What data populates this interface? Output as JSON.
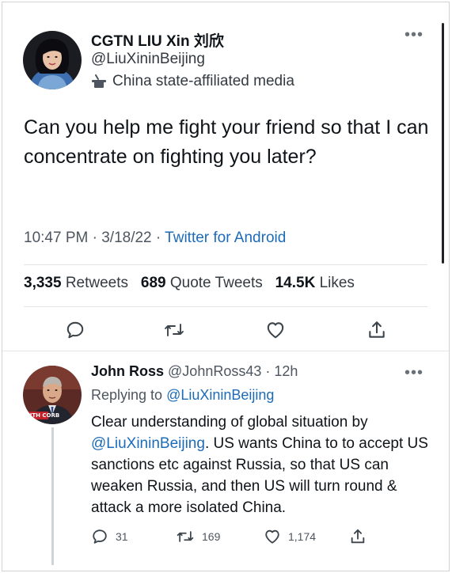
{
  "main_tweet": {
    "display_name": "CGTN LIU Xin 刘欣",
    "handle": "@LiuXininBeijing",
    "account_label": "China state-affiliated media",
    "more_icon": "more-horizontal-icon",
    "text": "Can you help me fight your friend so that I can concentrate on fighting you later?",
    "time": "10:47 PM",
    "date": "3/18/22",
    "separator": "·",
    "source": "Twitter for Android",
    "stats": {
      "retweets_count": "3,335",
      "retweets_label": "Retweets",
      "quotes_count": "689",
      "quotes_label": "Quote Tweets",
      "likes_count": "14.5K",
      "likes_label": "Likes"
    },
    "actions": [
      "reply-icon",
      "retweet-icon",
      "like-icon",
      "share-icon"
    ]
  },
  "reply_tweet": {
    "display_name": "John Ross",
    "handle": "@JohnRoss43",
    "separator": "·",
    "time_ago": "12h",
    "replying_prefix": "Replying to",
    "replying_handle": "@LiuXininBeijing",
    "avatar_banner_text": "WITH CORB",
    "text_before_mention": "Clear understanding of global situation by ",
    "mention": "@LiuXininBeijing",
    "text_after_mention": ". US wants China to to accept US sanctions etc against Russia, so that US can weaken Russia, and then US will turn round & attack a more isolated China.",
    "counts": {
      "replies": "31",
      "retweets": "169",
      "likes": "1,174"
    }
  },
  "colors": {
    "link": "#1d6bb8",
    "text": "#0f1419",
    "secondary": "#4d5660",
    "divider": "#e2e5e8"
  }
}
